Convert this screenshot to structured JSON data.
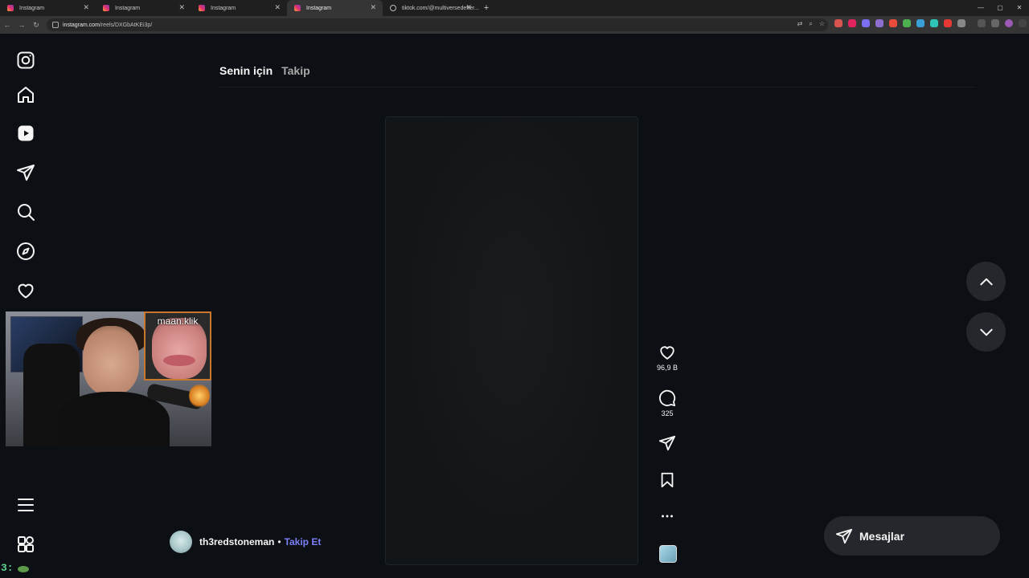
{
  "browser": {
    "tabs": [
      {
        "title": "Instagram",
        "active": false
      },
      {
        "title": "Instagram",
        "active": false
      },
      {
        "title": "Instagram",
        "active": false
      },
      {
        "title": "Instagram",
        "active": true
      },
      {
        "title": "tiktok.com/@multiversedefter...",
        "active": false
      }
    ],
    "url_host": "instagram.com",
    "url_path": "/reels/DXGbAtKEi3p/"
  },
  "sidebar": {
    "icons": [
      "instagram-logo-icon",
      "home-icon",
      "reels-icon",
      "direct-icon",
      "search-icon",
      "explore-icon",
      "heart-icon",
      "menu-icon",
      "more-apps-icon"
    ]
  },
  "feed": {
    "tabs": [
      {
        "label": "Senin için",
        "active": true
      },
      {
        "label": "Takip",
        "active": false
      }
    ]
  },
  "reel": {
    "likes": "96,9 B",
    "comments": "325",
    "author": "th3redstoneman",
    "separator": "•",
    "follow_label": "Takip Et"
  },
  "overlay": {
    "inset_label": "maan.klik",
    "corner_text": "3:"
  },
  "messages": {
    "label": "Mesajlar"
  }
}
